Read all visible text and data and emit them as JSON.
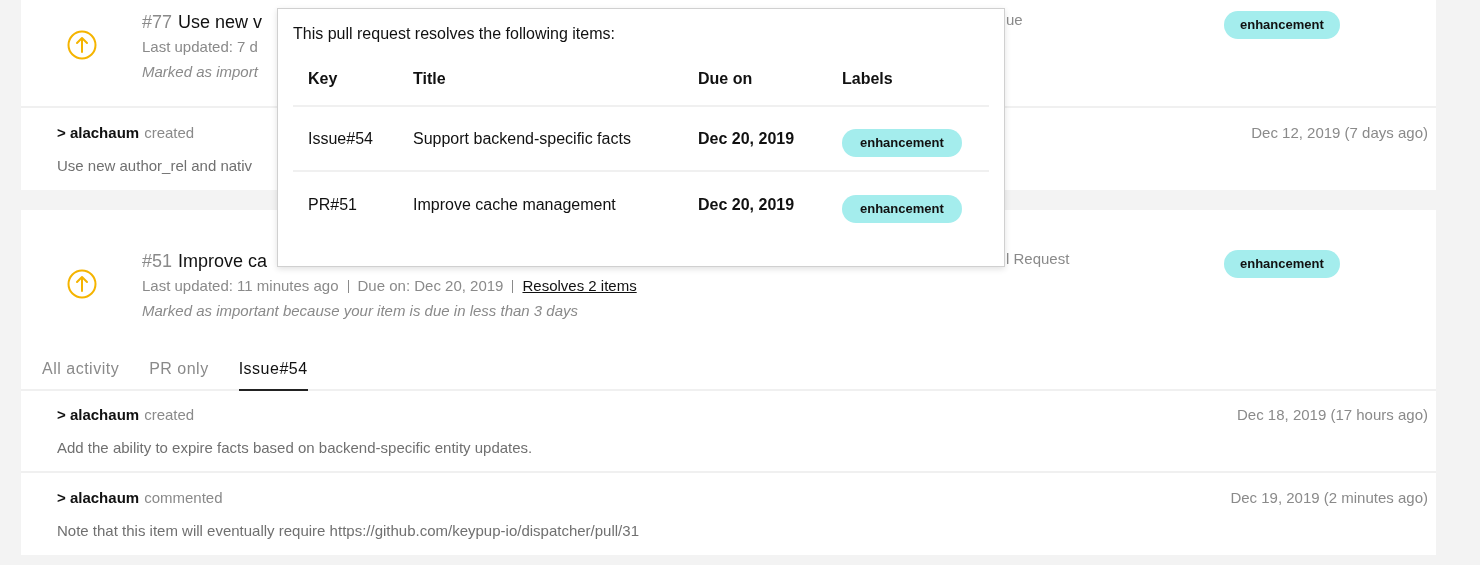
{
  "cards": [
    {
      "number": "#77",
      "title": "Use new v",
      "meta": [
        {
          "text": "Last updated: 7 d",
          "kind": "text"
        }
      ],
      "note": "Marked as import",
      "side_fragment": "ue",
      "label": "enhancement",
      "activities": [
        {
          "user": "> alachaum",
          "action": "created",
          "date": "Dec 12, 2019 (7 days ago)",
          "body": "Use new author_rel and nativ"
        }
      ]
    },
    {
      "number": "#51",
      "title": "Improve ca",
      "meta": [
        {
          "text": "Last updated: 11 minutes ago",
          "kind": "text"
        },
        {
          "text": "Due on: Dec 20, 2019",
          "kind": "text"
        },
        {
          "text": "Resolves 2 items",
          "kind": "link"
        }
      ],
      "note": "Marked as important because your item is due in less than 3 days",
      "side_fragment": "l Request",
      "label": "enhancement",
      "tabs": [
        {
          "label": "All activity",
          "selected": false
        },
        {
          "label": "PR only",
          "selected": false
        },
        {
          "label": "Issue#54",
          "selected": true
        }
      ],
      "activities": [
        {
          "user": "> alachaum",
          "action": "created",
          "date": "Dec 18, 2019 (17 hours ago)",
          "body": "Add the ability to expire facts based on backend-specific entity updates."
        },
        {
          "user": "> alachaum",
          "action": "commented",
          "date": "Dec 19, 2019 (2 minutes ago)",
          "body": "Note that this item will eventually require https://github.com/keypup-io/dispatcher/pull/31"
        }
      ]
    }
  ],
  "popover": {
    "intro": "This pull request resolves the following items:",
    "columns": [
      "Key",
      "Title",
      "Due on",
      "Labels"
    ],
    "rows": [
      {
        "key": "Issue#54",
        "title": "Support backend-specific facts",
        "due": "Dec 20, 2019",
        "label": "enhancement"
      },
      {
        "key": "PR#51",
        "title": "Improve cache management",
        "due": "Dec 20, 2019",
        "label": "enhancement"
      }
    ]
  }
}
